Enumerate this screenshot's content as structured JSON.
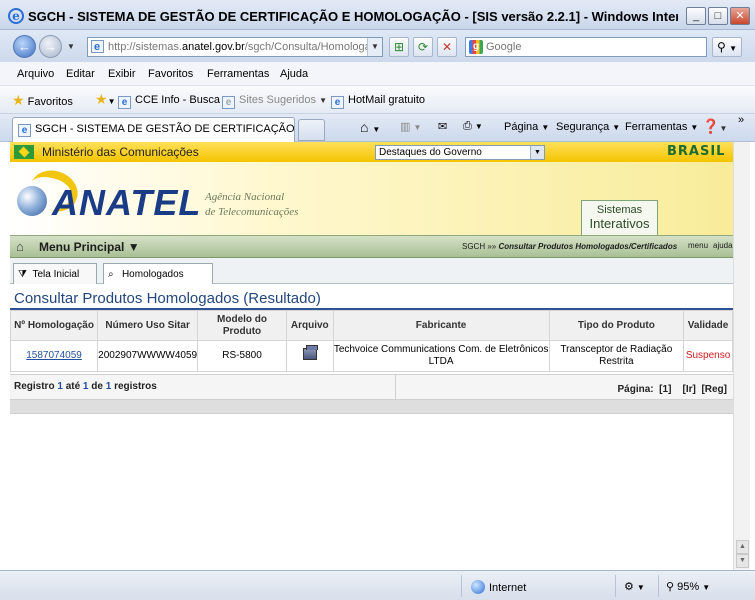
{
  "window": {
    "title": "SGCH - SISTEMA DE GESTÃO DE CERTIFICAÇÃO E HOMOLOGAÇÃO - [SIS versão 2.2.1] - Windows Internet Explo...",
    "minimize": "_",
    "maximize": "□",
    "close": "✕"
  },
  "address": {
    "prefix": "http://sistemas.",
    "domain": "anatel.gov.br",
    "path": "/sgch/Consulta/Homologac",
    "search_placeholder": "Google"
  },
  "menubar": [
    "Arquivo",
    "Editar",
    "Exibir",
    "Favoritos",
    "Ferramentas",
    "Ajuda"
  ],
  "favorites": {
    "label": "Favoritos",
    "items": [
      "CCE Info - Busca",
      "Sites Sugeridos",
      "HotMail gratuito"
    ]
  },
  "tab": {
    "title": "SGCH - SISTEMA DE GESTÃO DE CERTIFICAÇÃO E H..."
  },
  "commands": {
    "page": "Página",
    "security": "Segurança",
    "tools": "Ferramentas"
  },
  "gov": {
    "ministry": "Ministério das Comunicações",
    "select_value": "Destaques do Governo",
    "brasil": "BRASIL"
  },
  "header": {
    "logo": "ANATEL",
    "sub1": "Agência Nacional",
    "sub2": "de Telecomunicações",
    "systems1": "Sistemas",
    "systems2": "Interativos"
  },
  "menu": {
    "main": "Menu Principal",
    "crumb_root": "SGCH",
    "crumb_sep": " »» ",
    "crumb_page": "Consultar Produtos Homologados/Certificados",
    "link_menu": "menu",
    "link_help": "ajuda"
  },
  "pagetabs": [
    "Tela Inicial",
    "Homologados"
  ],
  "heading": "Consultar Produtos Homologados (Resultado)",
  "table": {
    "headers": [
      "Nº Homologação",
      "Número Uso Sitar",
      "Modelo do Produto",
      "Arquivo",
      "Fabricante",
      "Tipo do Produto",
      "Validade"
    ],
    "rows": [
      {
        "homologacao": "1587074059",
        "sitar": "2002907WWWW4059",
        "modelo": "RS-5800",
        "fabricante": "Techvoice Communications Com. de Eletrônicos LTDA",
        "tipo": "Transceptor de Radiação Restrita",
        "validade": "Suspenso"
      }
    ]
  },
  "footer": {
    "registro_label": "Registro",
    "n1": "1",
    "ate": "até",
    "n2": "1",
    "de": "de",
    "n3": "1",
    "registros": "registros",
    "pagina": "Página:",
    "page_num": "[1]",
    "ir": "[Ir]",
    "reg": "[Reg]"
  },
  "status": {
    "zone": "Internet",
    "zoom": "95%"
  },
  "colors": {
    "accent": "#23467f",
    "gov_yellow": "#f4c400",
    "menu_green": "#a9bf95",
    "suspended": "#d21b1b"
  }
}
